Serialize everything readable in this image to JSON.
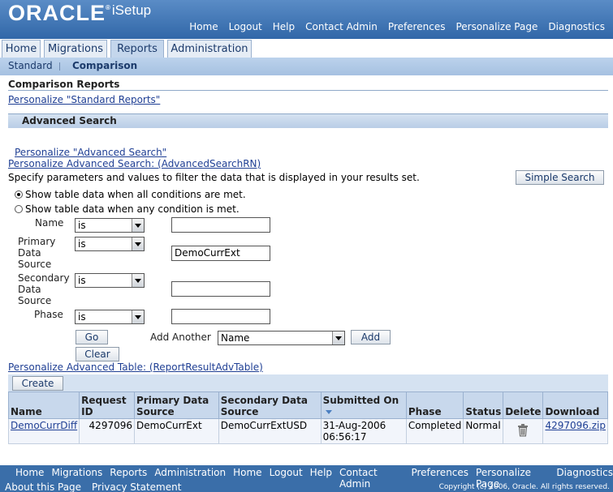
{
  "header": {
    "brand": "ORACLE",
    "product": "iSetup",
    "global_links": [
      "Home",
      "Logout",
      "Help",
      "Contact Admin",
      "Preferences",
      "Personalize Page",
      "Diagnostics"
    ]
  },
  "tabs": [
    {
      "label": "Home"
    },
    {
      "label": "Migrations"
    },
    {
      "label": "Reports",
      "active": true
    },
    {
      "label": "Administration"
    }
  ],
  "subtabs": [
    "Standard",
    "Comparison"
  ],
  "page": {
    "title": "Comparison Reports",
    "personalize_std": "Personalize \"Standard Reports\"",
    "section_title": "Advanced Search",
    "personalize_adv": "Personalize \"Advanced Search\"",
    "personalize_adv_rn": "Personalize Advanced Search: (AdvancedSearchRN)",
    "instructions": "Specify parameters and values to filter the data that is displayed in your results set.",
    "simple_search": "Simple Search",
    "radio_all": "Show table data when all conditions are met.",
    "radio_any": "Show table data when any condition is met."
  },
  "criteria": [
    {
      "label_lines": [
        "Name"
      ],
      "operator": "is",
      "value": ""
    },
    {
      "label_lines": [
        "Primary",
        "Data",
        "Source"
      ],
      "operator": "is",
      "value": "DemoCurrExt"
    },
    {
      "label_lines": [
        "Secondary",
        "Data",
        "Source"
      ],
      "operator": "is",
      "value": ""
    },
    {
      "label_lines": [
        "Phase"
      ],
      "operator": "is",
      "value": ""
    }
  ],
  "actions": {
    "go": "Go",
    "clear": "Clear",
    "add_another": "Add Another",
    "add_another_value": "Name",
    "add": "Add",
    "personalize_table": "Personalize Advanced Table: (ReportResultAdvTable)",
    "create": "Create"
  },
  "table": {
    "columns": [
      "Name",
      "Request ID",
      "Primary Data Source",
      "Secondary Data Source",
      "Submitted On",
      "Phase",
      "Status",
      "Delete",
      "Download"
    ],
    "rows": [
      {
        "name": "DemoCurrDiff",
        "request_id": "4297096",
        "primary": "DemoCurrExt",
        "secondary": "DemoCurrExtUSD",
        "submitted": "31-Aug-2006 06:56:17",
        "phase": "Completed",
        "status": "Normal",
        "download": "4297096.zip"
      }
    ]
  },
  "footer": {
    "links": [
      "Home",
      "Migrations",
      "Reports",
      "Administration",
      "Home",
      "Logout",
      "Help",
      "Contact Admin",
      "Preferences",
      "Personalize Page",
      "Diagnostics"
    ],
    "about": "About this Page",
    "privacy": "Privacy Statement",
    "copyright": "Copyright (c) 2006, Oracle. All rights reserved."
  },
  "colors": {
    "header_blue": "#3167a8",
    "tab_active": "#c4d6ec",
    "link": "#1f3f94"
  }
}
